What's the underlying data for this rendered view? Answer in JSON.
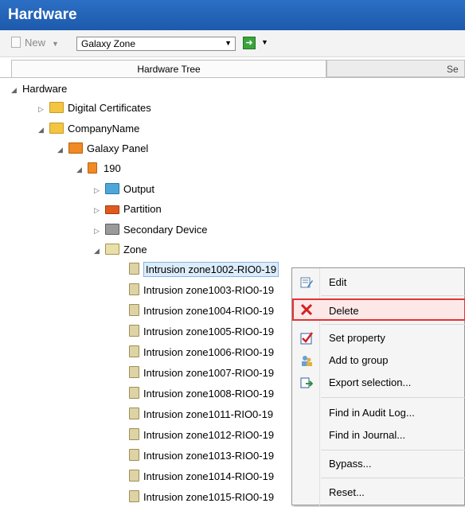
{
  "window": {
    "title": "Hardware"
  },
  "toolbar": {
    "new_label": "New",
    "combo_value": "Galaxy Zone"
  },
  "tabs": [
    {
      "label": "Hardware Tree"
    },
    {
      "label": "Se"
    }
  ],
  "tree": {
    "root": "Hardware",
    "digital_certificates": "Digital Certificates",
    "company": "CompanyName",
    "panel": "Galaxy Panel",
    "device": "190",
    "output": "Output",
    "partition": "Partition",
    "secondary": "Secondary Device",
    "zone": "Zone",
    "zones": [
      "Intrusion zone1002-RIO0-19",
      "Intrusion zone1003-RIO0-19",
      "Intrusion zone1004-RIO0-19",
      "Intrusion zone1005-RIO0-19",
      "Intrusion zone1006-RIO0-19",
      "Intrusion zone1007-RIO0-19",
      "Intrusion zone1008-RIO0-19",
      "Intrusion zone1011-RIO0-19",
      "Intrusion zone1012-RIO0-19",
      "Intrusion zone1013-RIO0-19",
      "Intrusion zone1014-RIO0-19",
      "Intrusion zone1015-RIO0-19"
    ]
  },
  "context_menu": {
    "edit": "Edit",
    "delete": "Delete",
    "set_property": "Set property",
    "add_to_group": "Add to group",
    "export_selection": "Export selection...",
    "find_audit": "Find in Audit Log...",
    "find_journal": "Find in Journal...",
    "bypass": "Bypass...",
    "reset": "Reset..."
  },
  "colors": {
    "title_bar": "#1d5aac",
    "delete_highlight_border": "#e03535"
  }
}
